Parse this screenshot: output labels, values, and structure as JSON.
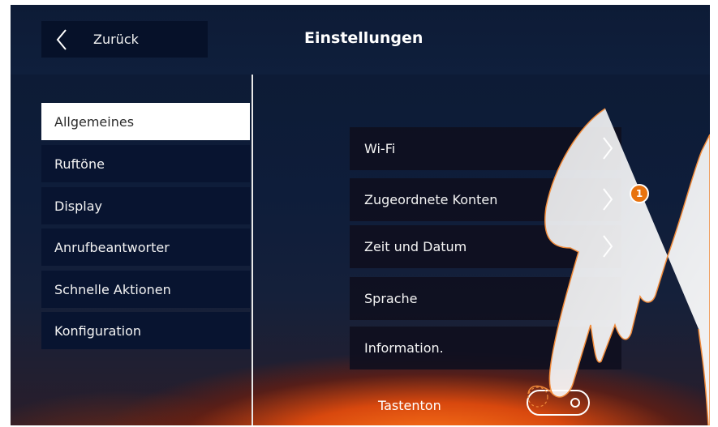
{
  "header": {
    "back_label": "Zurück",
    "title": "Einstellungen"
  },
  "sidebar": {
    "items": [
      {
        "label": "Allgemeines",
        "active": true
      },
      {
        "label": "Ruftöne",
        "active": false
      },
      {
        "label": "Display",
        "active": false
      },
      {
        "label": "Anrufbeantworter",
        "active": false
      },
      {
        "label": "Schnelle Aktionen",
        "active": false
      },
      {
        "label": "Konfiguration",
        "active": false
      }
    ]
  },
  "menu": {
    "items": [
      {
        "label": "Wi-Fi"
      },
      {
        "label": "Zugeordnete Konten"
      },
      {
        "label": "Zeit und Datum"
      },
      {
        "label": "Sprache"
      },
      {
        "label": "Information."
      }
    ]
  },
  "tastenton": {
    "label": "Tastenton",
    "enabled": false
  },
  "callout": {
    "number": "1",
    "color": "#e8730f"
  },
  "colors": {
    "panel": "#081430",
    "active_item": "#ffffff",
    "accent_glow": "#ff7a1a"
  }
}
